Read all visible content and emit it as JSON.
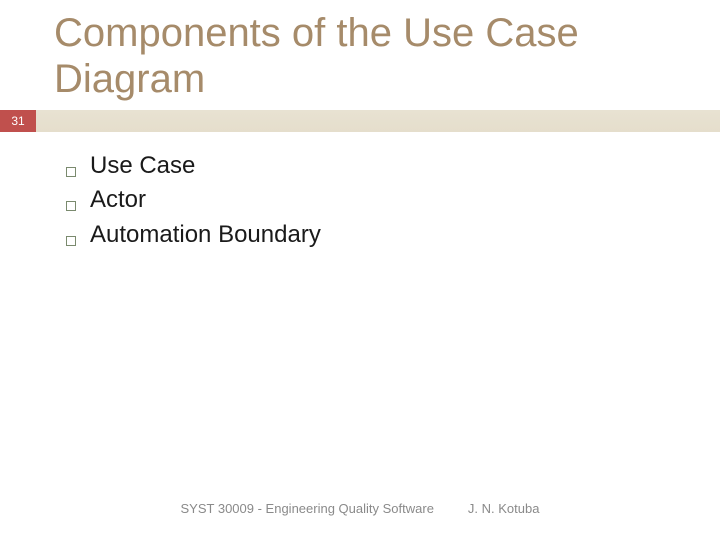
{
  "slide": {
    "number": "31",
    "title": "Components of the Use Case Diagram",
    "bullets": [
      {
        "text": "Use Case"
      },
      {
        "text": "Actor"
      },
      {
        "text": "Automation Boundary"
      }
    ],
    "footer": {
      "course": "SYST 30009 - Engineering Quality Software",
      "author": "J. N. Kotuba"
    }
  }
}
